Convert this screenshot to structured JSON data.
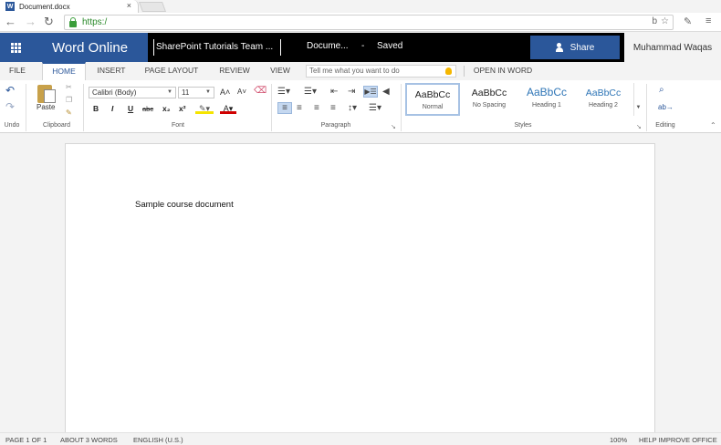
{
  "browser": {
    "tab_title": "Document.docx",
    "tab_close": "×",
    "url": "https:/",
    "nav": {
      "back": "←",
      "forward": "→",
      "reload": "↻"
    },
    "toolbar_right": {
      "ext_b": "b",
      "star": "☆",
      "ext2": "✎",
      "menu": "≡"
    }
  },
  "header": {
    "app_name": "Word Online",
    "site_name": "SharePoint Tutorials Team ...",
    "doc_name": "Docume...",
    "separator": "-",
    "save_status": "Saved",
    "share_label": "Share",
    "user_name": "Muhammad Waqas"
  },
  "ribbon_tabs": [
    {
      "label": "FILE"
    },
    {
      "label": "HOME",
      "active": true
    },
    {
      "label": "INSERT"
    },
    {
      "label": "PAGE LAYOUT"
    },
    {
      "label": "REVIEW"
    },
    {
      "label": "VIEW"
    }
  ],
  "tell_me": {
    "placeholder": "Tell me what you want to do"
  },
  "open_in_word": "OPEN IN WORD",
  "ribbon": {
    "undo": {
      "label": "Undo"
    },
    "clipboard": {
      "label": "Clipboard",
      "paste": "Paste"
    },
    "font": {
      "label": "Font",
      "family": "Calibri (Body)",
      "size": "11",
      "grow": "A˄",
      "shrink": "A˅",
      "bold": "B",
      "italic": "I",
      "underline": "U",
      "strike": "abc",
      "subscript": "x₂",
      "superscript": "x²",
      "color": "A"
    },
    "paragraph": {
      "label": "Paragraph"
    },
    "styles": {
      "label": "Styles",
      "items": [
        {
          "sample": "AaBbCc",
          "name": "Normal",
          "selected": true
        },
        {
          "sample": "AaBbCc",
          "name": "No Spacing"
        },
        {
          "sample": "AaBbCc",
          "name": "Heading 1"
        },
        {
          "sample": "AaBbCc",
          "name": "Heading 2"
        }
      ]
    },
    "editing": {
      "label": "Editing"
    }
  },
  "document": {
    "body_text": "Sample course document"
  },
  "status_bar": {
    "page": "PAGE 1 OF 1",
    "words": "ABOUT 3 WORDS",
    "language": "ENGLISH (U.S.)",
    "zoom": "100%",
    "help": "HELP IMPROVE OFFICE"
  },
  "colors": {
    "brand_blue": "#2b579a",
    "header_black": "#000000",
    "heading_blue": "#2e75b6"
  }
}
